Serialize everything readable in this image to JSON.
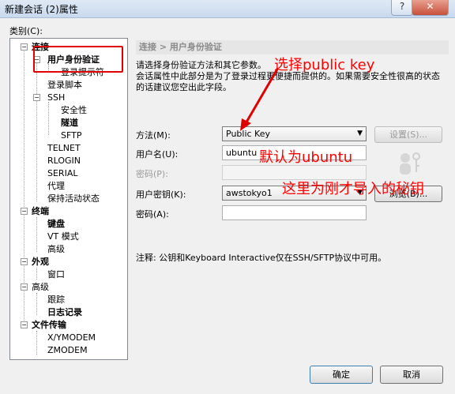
{
  "window": {
    "title": "新建会话 (2)属性",
    "help_label": "?",
    "close_label": "✕"
  },
  "category_label": "类别(C):",
  "tree": {
    "n1": "连接",
    "n2": "用户身份验证",
    "n3": "登录提示符",
    "n4": "登录脚本",
    "n5": "SSH",
    "n6": "安全性",
    "n7": "隧道",
    "n8": "SFTP",
    "n9": "TELNET",
    "n10": "RLOGIN",
    "n11": "SERIAL",
    "n12": "代理",
    "n13": "保持活动状态",
    "n14": "终端",
    "n15": "键盘",
    "n16": "VT 模式",
    "n17": "高级",
    "n18": "外观",
    "n19": "窗口",
    "n20": "高级",
    "n21": "跟踪",
    "n22": "日志记录",
    "n23": "文件传输",
    "n24": "X/YMODEM",
    "n25": "ZMODEM"
  },
  "panel": {
    "title": "连接 > 用户身份验证",
    "description": "请选择身份验证方法和其它参数。\n会话属性中此部分是为了登录过程更便捷而提供的。如果需要安全性很高的状态的话建议您空出此字段。",
    "method_label": "方法(M):",
    "method_value": "Public Key",
    "setup_button": "设置(S)...",
    "username_label": "用户名(U):",
    "username_value": "ubuntu",
    "password_label": "密码(P):",
    "userkey_label": "用户密钥(K):",
    "userkey_value": "awstokyo1",
    "browse_button": "浏览(B)...",
    "passphrase_label": "密码(A):",
    "note": "注释: 公钥和Keyboard Interactive仅在SSH/SFTP协议中可用。"
  },
  "annotations": {
    "select_key": "选择public key",
    "default_ubuntu": "默认为ubuntu",
    "key_here": "这里为刚才导入的秘钥"
  },
  "footer": {
    "ok": "确定",
    "cancel": "取消"
  }
}
